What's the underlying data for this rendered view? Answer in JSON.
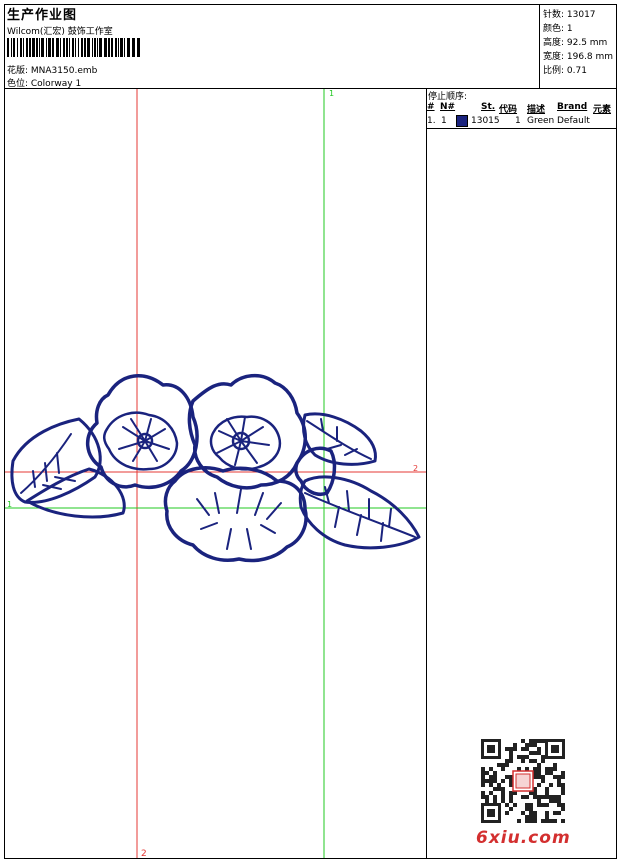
{
  "header": {
    "title": "生产作业图",
    "studio": "Wilcom(汇宏) 鼓饰工作室",
    "design_line": "花版:  MNA3150.emb",
    "colorway_line": "色位:  Colorway 1"
  },
  "stats": [
    "针数: 13017",
    "颜色: 1",
    "高度: 92.5 mm",
    "宽度: 196.8 mm",
    "比例: 0.71"
  ],
  "canvas": {
    "markers": {
      "top_green": "1",
      "left_green": "1",
      "right_red": "2",
      "bottom_red": "2"
    },
    "colors": {
      "red_guide": "#e53935",
      "green_guide": "#22c822",
      "thread": "#1a237e"
    }
  },
  "stop_sequence": {
    "title": "停止顺序:",
    "columns": [
      "#",
      "N#",
      "St.",
      "代码",
      "描述",
      "Brand",
      "元素"
    ],
    "rows": [
      {
        "index": "1.",
        "needle": "1",
        "stitches": "13015",
        "code": "1",
        "description": "Green",
        "brand": "Default",
        "element": ""
      }
    ]
  },
  "watermark": {
    "site": "6xiu.com"
  }
}
